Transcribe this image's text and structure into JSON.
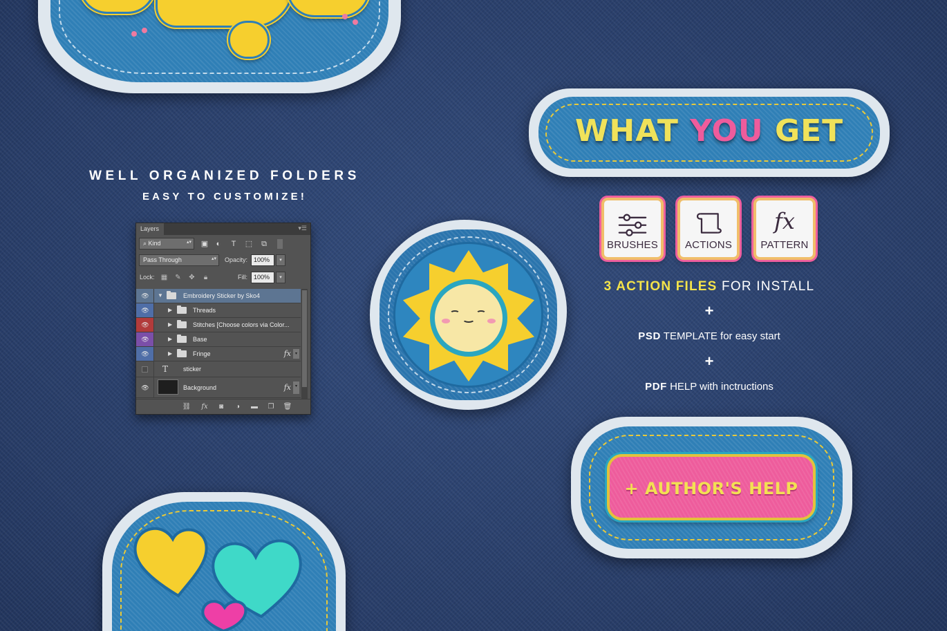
{
  "folders_section": {
    "title": "WELL ORGANIZED FOLDERS",
    "subtitle": "EASY TO CUSTOMIZE!"
  },
  "layers_panel": {
    "tab": "Layers",
    "filter_kind": "Kind",
    "blend_mode": "Pass Through",
    "opacity_label": "Opacity:",
    "opacity_value": "100%",
    "lock_label": "Lock:",
    "fill_label": "Fill:",
    "fill_value": "100%",
    "layers": [
      {
        "name": "Embroidery Sticker by Sko4",
        "eye_color": "#535353",
        "type": "group-open",
        "visible": true,
        "selected": true
      },
      {
        "name": "Threads",
        "eye_color": "#4f6ea7",
        "type": "group",
        "visible": true
      },
      {
        "name": "Stitches [Choose colors via Color...",
        "eye_color": "#b23b3b",
        "type": "group",
        "visible": true
      },
      {
        "name": "Base",
        "eye_color": "#7b4fa8",
        "type": "group",
        "visible": true
      },
      {
        "name": "Fringe",
        "eye_color": "#4f6ea7",
        "type": "group",
        "visible": true,
        "fx": "fx"
      },
      {
        "name": "sticker",
        "eye_color": "#535353",
        "type": "text",
        "visible": false,
        "type_glyph": "T"
      },
      {
        "name": "Background",
        "eye_color": "#535353",
        "type": "pixel",
        "visible": true,
        "fx": "fx"
      }
    ],
    "bottom_fx": "fx"
  },
  "banner": {
    "word1": "WHAT",
    "word2": "YOU",
    "word3": "GET"
  },
  "tiles": [
    {
      "label": "BRUSHES",
      "icon": "sliders-icon"
    },
    {
      "label": "ACTIONS",
      "icon": "scroll-icon"
    },
    {
      "label": "PATTERN",
      "icon": "fx-icon",
      "glyph": "fx"
    }
  ],
  "info": {
    "action_highlight": "3 ACTION FILES",
    "action_rest": " FOR INSTALL",
    "plus": "+",
    "psd_bold": "PSD",
    "psd_rest": " TEMPLATE for easy start",
    "pdf_bold": "PDF",
    "pdf_rest": " HELP with inctructions"
  },
  "help_button": {
    "label": "+ AUTHOR'S HELP"
  },
  "colors": {
    "denim_background": "#2c4270",
    "patch_blue": "#2f7fb6",
    "thread_yellow": "#f6cf2e",
    "thread_pink": "#ee5c9c",
    "thread_cyan": "#3fd9c8",
    "highlight_yellow": "#f4e34a"
  }
}
